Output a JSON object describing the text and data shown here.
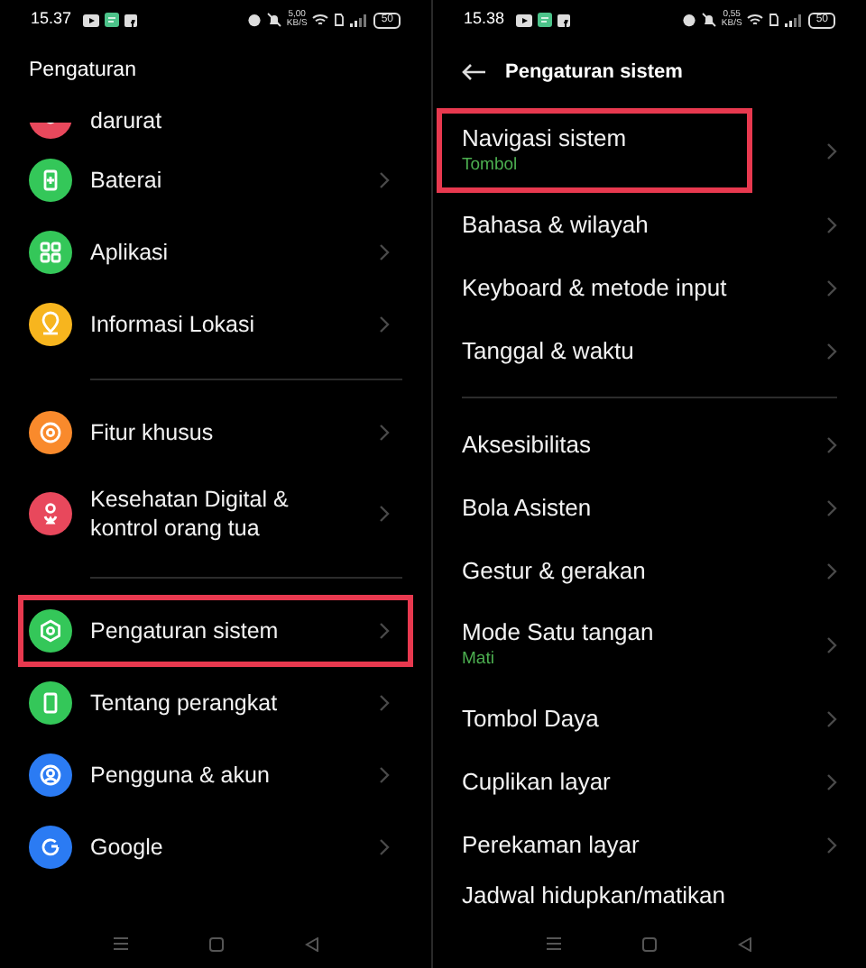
{
  "screens": [
    {
      "status": {
        "time": "15.37",
        "speed_value": "5,00",
        "speed_unit": "KB/S",
        "battery": "50"
      },
      "header": {
        "title": "Pengaturan",
        "back": false
      },
      "items": [
        {
          "kind": "partial",
          "label": "darurat",
          "color": "#e8485c",
          "highlighted": false
        },
        {
          "kind": "item",
          "label": "Baterai",
          "color": "#34c759",
          "highlighted": false
        },
        {
          "kind": "item",
          "label": "Aplikasi",
          "color": "#34c759",
          "highlighted": false
        },
        {
          "kind": "item",
          "label": "Informasi Lokasi",
          "color": "#f7b51e",
          "highlighted": false
        },
        {
          "kind": "divider"
        },
        {
          "kind": "item",
          "label": "Fitur khusus",
          "color": "#f98a2c",
          "highlighted": false
        },
        {
          "kind": "item",
          "label": "Kesehatan Digital & kontrol orang tua",
          "color": "#e8485c",
          "highlighted": false
        },
        {
          "kind": "divider"
        },
        {
          "kind": "item",
          "label": "Pengaturan sistem",
          "color": "#34c759",
          "highlighted": true
        },
        {
          "kind": "item",
          "label": "Tentang perangkat",
          "color": "#34c759",
          "highlighted": false
        },
        {
          "kind": "item",
          "label": "Pengguna & akun",
          "color": "#2b7bf3",
          "highlighted": false
        },
        {
          "kind": "item",
          "label": "Google",
          "color": "#2b7bf3",
          "highlighted": false
        }
      ]
    },
    {
      "status": {
        "time": "15.38",
        "speed_value": "0,55",
        "speed_unit": "KB/S",
        "battery": "50"
      },
      "header": {
        "title": "Pengaturan sistem",
        "back": true
      },
      "items": [
        {
          "kind": "item",
          "label": "Navigasi sistem",
          "subtitle": "Tombol",
          "highlighted": true
        },
        {
          "kind": "item",
          "label": "Bahasa & wilayah",
          "highlighted": false
        },
        {
          "kind": "item",
          "label": "Keyboard & metode input",
          "highlighted": false
        },
        {
          "kind": "item",
          "label": "Tanggal & waktu",
          "highlighted": false
        },
        {
          "kind": "divider"
        },
        {
          "kind": "item",
          "label": "Aksesibilitas",
          "highlighted": false
        },
        {
          "kind": "item",
          "label": "Bola Asisten",
          "highlighted": false
        },
        {
          "kind": "item",
          "label": "Gestur & gerakan",
          "highlighted": false
        },
        {
          "kind": "item",
          "label": "Mode Satu tangan",
          "subtitle": "Mati",
          "highlighted": false
        },
        {
          "kind": "item",
          "label": "Tombol Daya",
          "highlighted": false
        },
        {
          "kind": "item",
          "label": "Cuplikan layar",
          "highlighted": false
        },
        {
          "kind": "item",
          "label": "Perekaman layar",
          "highlighted": false
        },
        {
          "kind": "partial",
          "label": "Jadwal hidupkan/matikan",
          "highlighted": false
        }
      ]
    }
  ]
}
